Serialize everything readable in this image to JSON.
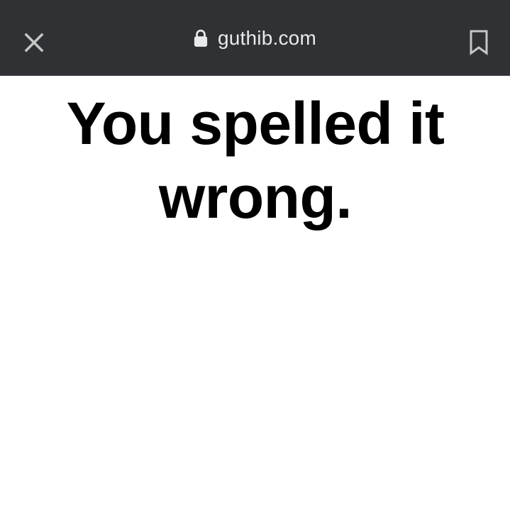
{
  "browser": {
    "url": "guthib.com",
    "icons": {
      "close": "close-icon",
      "lock": "lock-icon",
      "bookmark": "bookmark-icon"
    },
    "colors": {
      "toolbar_bg": "#303134",
      "url_text": "#e8eaed",
      "icon": "#c4c7c5"
    }
  },
  "page": {
    "headline": "You spelled it wrong.",
    "colors": {
      "background": "#ffffff",
      "text": "#000000"
    }
  }
}
